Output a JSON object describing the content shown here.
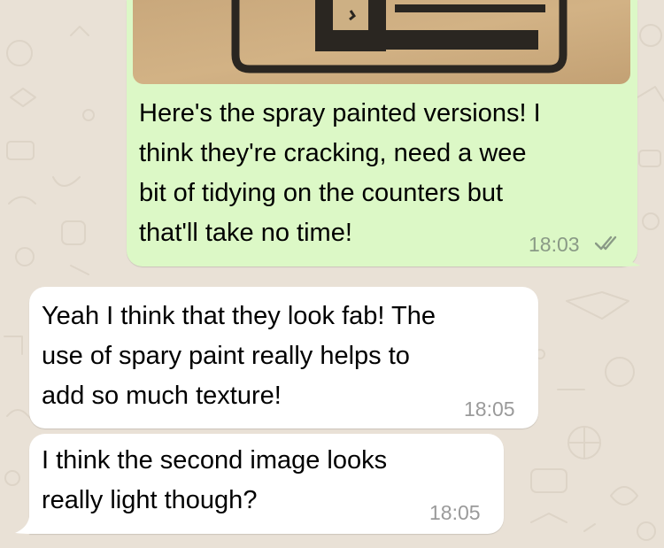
{
  "colors": {
    "chat_background": "#e9e1d6",
    "outgoing_bubble": "#dcf8c6",
    "incoming_bubble": "#ffffff",
    "read_ticks": "#8a9a86"
  },
  "messages": [
    {
      "direction": "outgoing",
      "has_image": true,
      "text": "Here's the spray painted versions! I\nthink they're cracking, need a wee\nbit of tidying on the counters but\nthat'll take no time!",
      "time": "18:03",
      "status_icon": "double-check-icon"
    },
    {
      "direction": "incoming",
      "text": "Yeah I think that they look fab! The\nuse of spary paint really helps to\nadd so much texture!",
      "time": "18:05"
    },
    {
      "direction": "incoming",
      "text": "I think the second image looks\nreally light though?",
      "time": "18:05"
    }
  ]
}
